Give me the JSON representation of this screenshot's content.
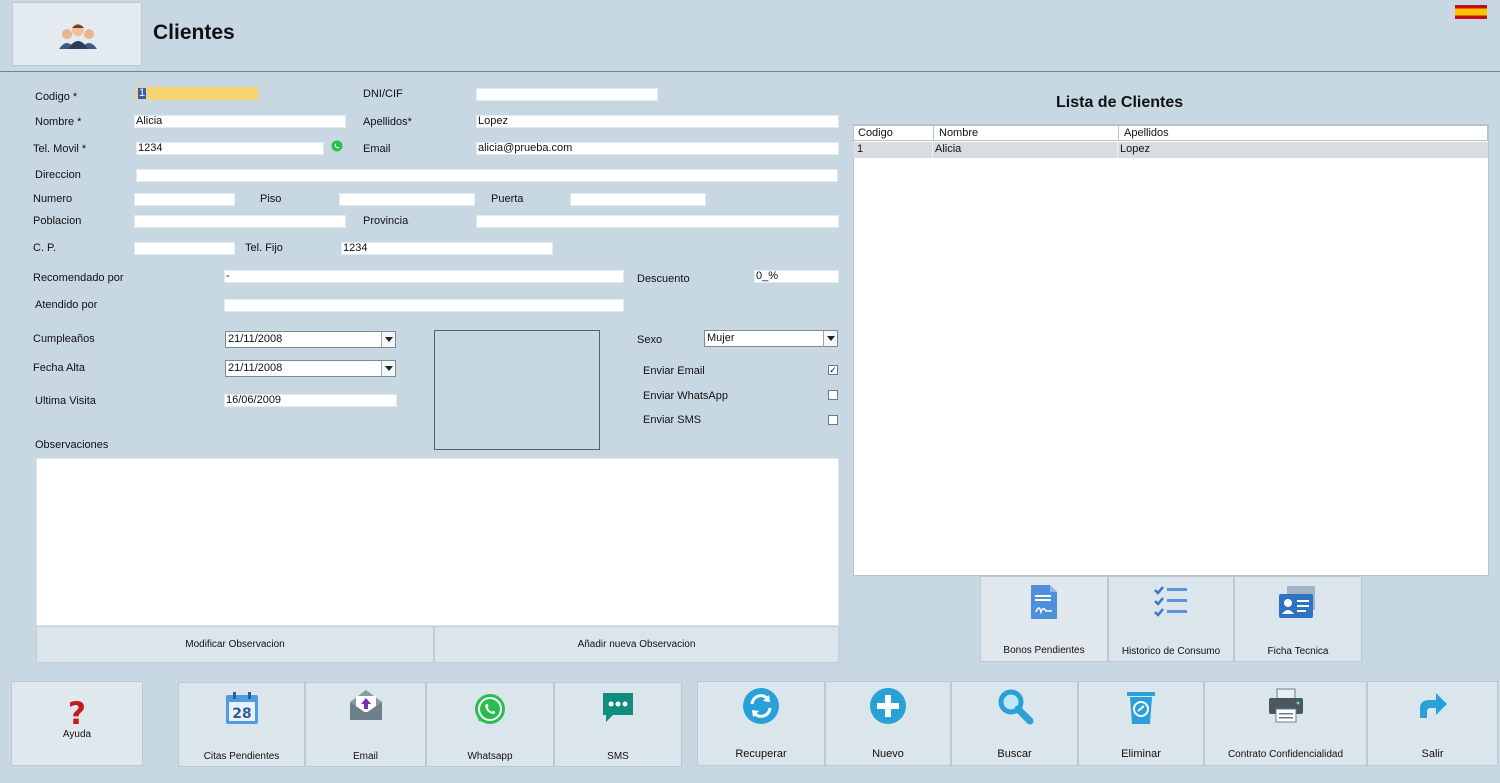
{
  "header": {
    "title": "Clientes",
    "icon": "users-icon",
    "flag": "spain-flag-icon"
  },
  "form": {
    "codigo_label": "Codigo *",
    "codigo_value": "1",
    "dni_label": "DNI/CIF",
    "dni_value": "",
    "nombre_label": "Nombre *",
    "nombre_value": "Alicia",
    "apellidos_label": "Apellidos*",
    "apellidos_value": "Lopez",
    "movil_label": "Tel. Movil *",
    "movil_value": "1234",
    "email_label": "Email",
    "email_value": "alicia@prueba.com",
    "direccion_label": "Direccion",
    "direccion_value": "",
    "numero_label": "Numero",
    "numero_value": "",
    "piso_label": "Piso",
    "piso_value": "",
    "puerta_label": "Puerta",
    "puerta_value": "",
    "poblacion_label": "Poblacion",
    "poblacion_value": "",
    "provincia_label": "Provincia",
    "provincia_value": "",
    "cp_label": "C. P.",
    "cp_value": "",
    "fijo_label": "Tel. Fijo",
    "fijo_value": "1234",
    "recomendado_label": "Recomendado por",
    "recomendado_value": "-",
    "descuento_label": "Descuento",
    "descuento_value": "0_%",
    "atendido_label": "Atendido por",
    "atendido_value": "",
    "cumple_label": "Cumpleaños",
    "cumple_value": "21/11/2008",
    "alta_label": "Fecha Alta",
    "alta_value": "21/11/2008",
    "ultima_label": "Ultima Visita",
    "ultima_value": "16/06/2009",
    "sexo_label": "Sexo",
    "sexo_value": "Mujer",
    "enviar_email_label": "Enviar Email",
    "enviar_email_checked": true,
    "enviar_whatsapp_label": "Enviar WhatsApp",
    "enviar_whatsapp_checked": false,
    "enviar_sms_label": "Enviar SMS",
    "enviar_sms_checked": false,
    "observaciones_label": "Observaciones",
    "modificar_obs": "Modificar Observacion",
    "nueva_obs": "Añadir nueva Observacion"
  },
  "list": {
    "title": "Lista de Clientes",
    "columns": [
      "Codigo",
      "Nombre",
      "Apellidos"
    ],
    "rows": [
      [
        "1",
        "Alicia",
        "Lopez"
      ]
    ]
  },
  "side_buttons": [
    {
      "label": "Bonos Pendientes",
      "icon": "document-signature-icon"
    },
    {
      "label": "Historico de Consumo",
      "icon": "checklist-icon"
    },
    {
      "label": "Ficha Tecnica",
      "icon": "id-card-icon"
    }
  ],
  "bottom": {
    "ayuda": "Ayuda",
    "comms": [
      {
        "label": "Citas Pendientes",
        "icon": "calendar-icon",
        "day": "28"
      },
      {
        "label": "Email",
        "icon": "envelope-icon"
      },
      {
        "label": "Whatsapp",
        "icon": "whatsapp-icon"
      },
      {
        "label": "SMS",
        "icon": "sms-icon"
      }
    ],
    "actions": [
      {
        "label": "Recuperar",
        "icon": "refresh-icon"
      },
      {
        "label": "Nuevo",
        "icon": "plus-icon"
      },
      {
        "label": "Buscar",
        "icon": "search-icon"
      },
      {
        "label": "Eliminar",
        "icon": "trash-icon"
      },
      {
        "label": "Contrato Confidencialidad",
        "icon": "printer-icon"
      },
      {
        "label": "Salir",
        "icon": "exit-arrow-icon"
      }
    ]
  },
  "colors": {
    "background": "#c7d8e3",
    "highlight": "#f6d46f",
    "accent": "#2aa0d8"
  }
}
